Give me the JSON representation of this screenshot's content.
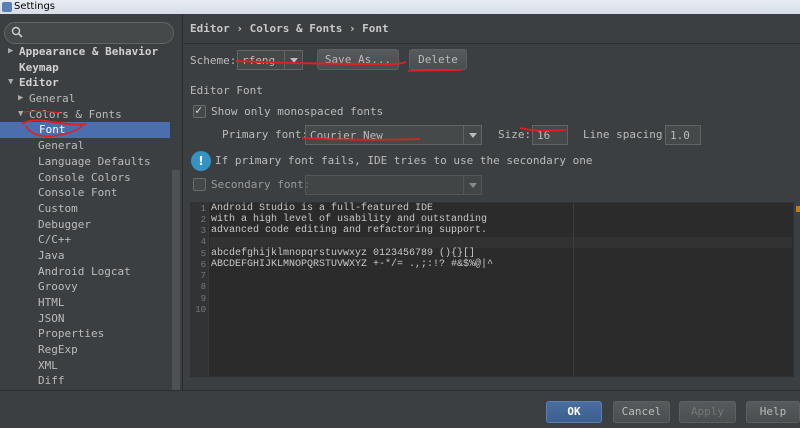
{
  "window": {
    "title": "Settings"
  },
  "search": {
    "placeholder": ""
  },
  "tree": [
    {
      "label": "Appearance & Behavior",
      "arrow": "▶"
    },
    {
      "label": "Keymap",
      "arrow": ""
    },
    {
      "label": "Editor",
      "arrow": "▼"
    },
    {
      "label": "General",
      "arrow": "▶"
    },
    {
      "label": "Colors & Fonts",
      "arrow": "▼"
    },
    {
      "label": "Font",
      "arrow": ""
    },
    {
      "label": "General",
      "arrow": ""
    },
    {
      "label": "Language Defaults",
      "arrow": ""
    },
    {
      "label": "Console Colors",
      "arrow": ""
    },
    {
      "label": "Console Font",
      "arrow": ""
    },
    {
      "label": "Custom",
      "arrow": ""
    },
    {
      "label": "Debugger",
      "arrow": ""
    },
    {
      "label": "C/C++",
      "arrow": ""
    },
    {
      "label": "Java",
      "arrow": ""
    },
    {
      "label": "Android Logcat",
      "arrow": ""
    },
    {
      "label": "Groovy",
      "arrow": ""
    },
    {
      "label": "HTML",
      "arrow": ""
    },
    {
      "label": "JSON",
      "arrow": ""
    },
    {
      "label": "Properties",
      "arrow": ""
    },
    {
      "label": "RegExp",
      "arrow": ""
    },
    {
      "label": "XML",
      "arrow": ""
    },
    {
      "label": "Diff",
      "arrow": ""
    }
  ],
  "header": {
    "breadcrumb": "Editor › Colors & Fonts › Font"
  },
  "scheme": {
    "label": "Scheme:",
    "value": "rfeng",
    "save_as": "Save As...",
    "delete": "Delete"
  },
  "editor_font": {
    "section_title": "Editor Font",
    "mono_only": "Show only monospaced fonts",
    "primary_label": "Primary font:",
    "primary_value": "Courier New",
    "size_label": "Size:",
    "size_value": "16",
    "spacing_label": "Line spacing:",
    "spacing_value": "1.0",
    "info": "If primary font fails, IDE tries to use the secondary one",
    "secondary_label": "Secondary font:",
    "secondary_value": ""
  },
  "preview": {
    "line_numbers": [
      "1",
      "2",
      "3",
      "4",
      "5",
      "6",
      "7",
      "8",
      "9",
      "10"
    ],
    "lines": [
      "Android Studio is a full-featured IDE",
      "with a high level of usability and outstanding",
      "advanced code editing and refactoring support.",
      "",
      "abcdefghijklmnopqrstuvwxyz 0123456789 (){}[]",
      "ABCDEFGHIJKLMNOPQRSTUVWXYZ +-*/= .,;:!? #&$%@|^",
      "",
      "",
      "",
      ""
    ]
  },
  "footer": {
    "ok": "OK",
    "cancel": "Cancel",
    "apply": "Apply",
    "help": "Help"
  },
  "colors": {
    "selection": "#4b6eaf",
    "annotation": "#e02020"
  }
}
